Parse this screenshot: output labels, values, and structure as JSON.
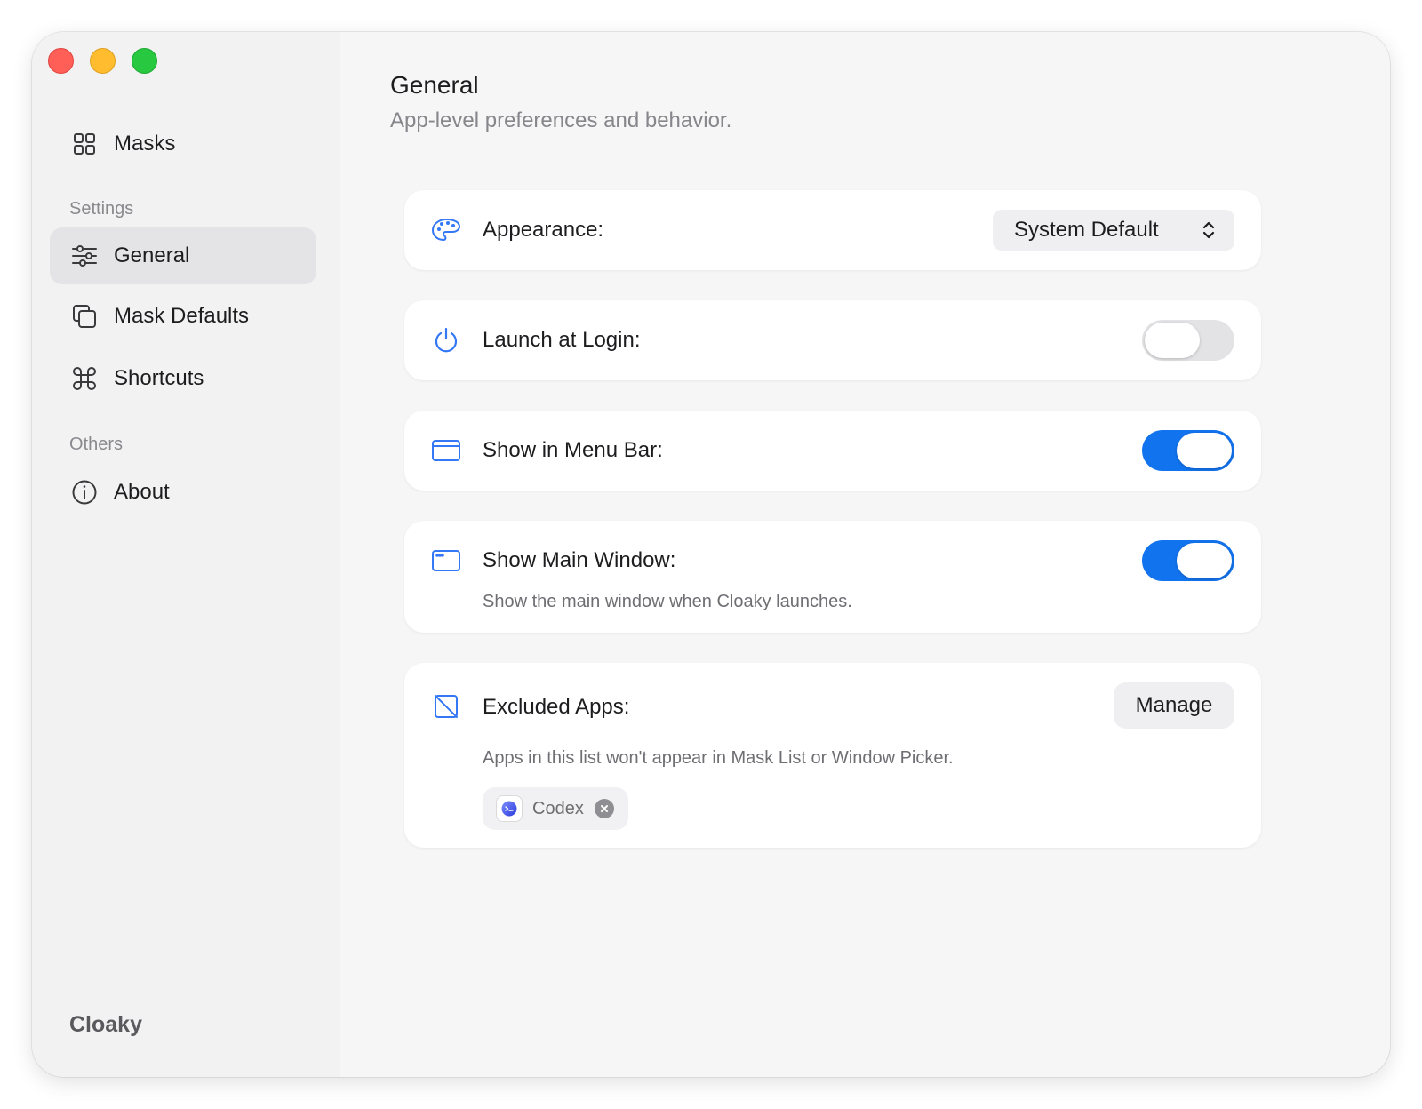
{
  "window": {
    "controls": [
      "close",
      "minimize",
      "zoom"
    ]
  },
  "sidebar": {
    "top_item": {
      "label": "Masks",
      "icon": "grid-icon"
    },
    "sections": [
      {
        "title": "Settings",
        "items": [
          {
            "label": "General",
            "icon": "sliders-icon",
            "selected": true
          },
          {
            "label": "Mask Defaults",
            "icon": "copy-icon",
            "selected": false
          },
          {
            "label": "Shortcuts",
            "icon": "command-icon",
            "selected": false
          }
        ]
      },
      {
        "title": "Others",
        "items": [
          {
            "label": "About",
            "icon": "info-icon",
            "selected": false
          }
        ]
      }
    ],
    "app_name": "Cloaky"
  },
  "main": {
    "title": "General",
    "subtitle": "App-level preferences and behavior.",
    "settings": {
      "appearance": {
        "label": "Appearance:",
        "value": "System Default",
        "icon": "palette-icon"
      },
      "launch_at_login": {
        "label": "Launch at Login:",
        "enabled": false,
        "icon": "power-icon"
      },
      "show_in_menu_bar": {
        "label": "Show in Menu Bar:",
        "enabled": true,
        "icon": "window-icon"
      },
      "show_main_window": {
        "label": "Show Main Window:",
        "enabled": true,
        "icon": "window-icon",
        "description": "Show the main window when Cloaky launches."
      },
      "excluded_apps": {
        "label": "Excluded Apps:",
        "icon": "slash-square-icon",
        "button_label": "Manage",
        "description": "Apps in this list won't appear in Mask List or Window Picker.",
        "apps": [
          {
            "name": "Codex"
          }
        ]
      }
    }
  },
  "colors": {
    "accent": "#1273ee",
    "icon_tint": "#3478f6"
  }
}
